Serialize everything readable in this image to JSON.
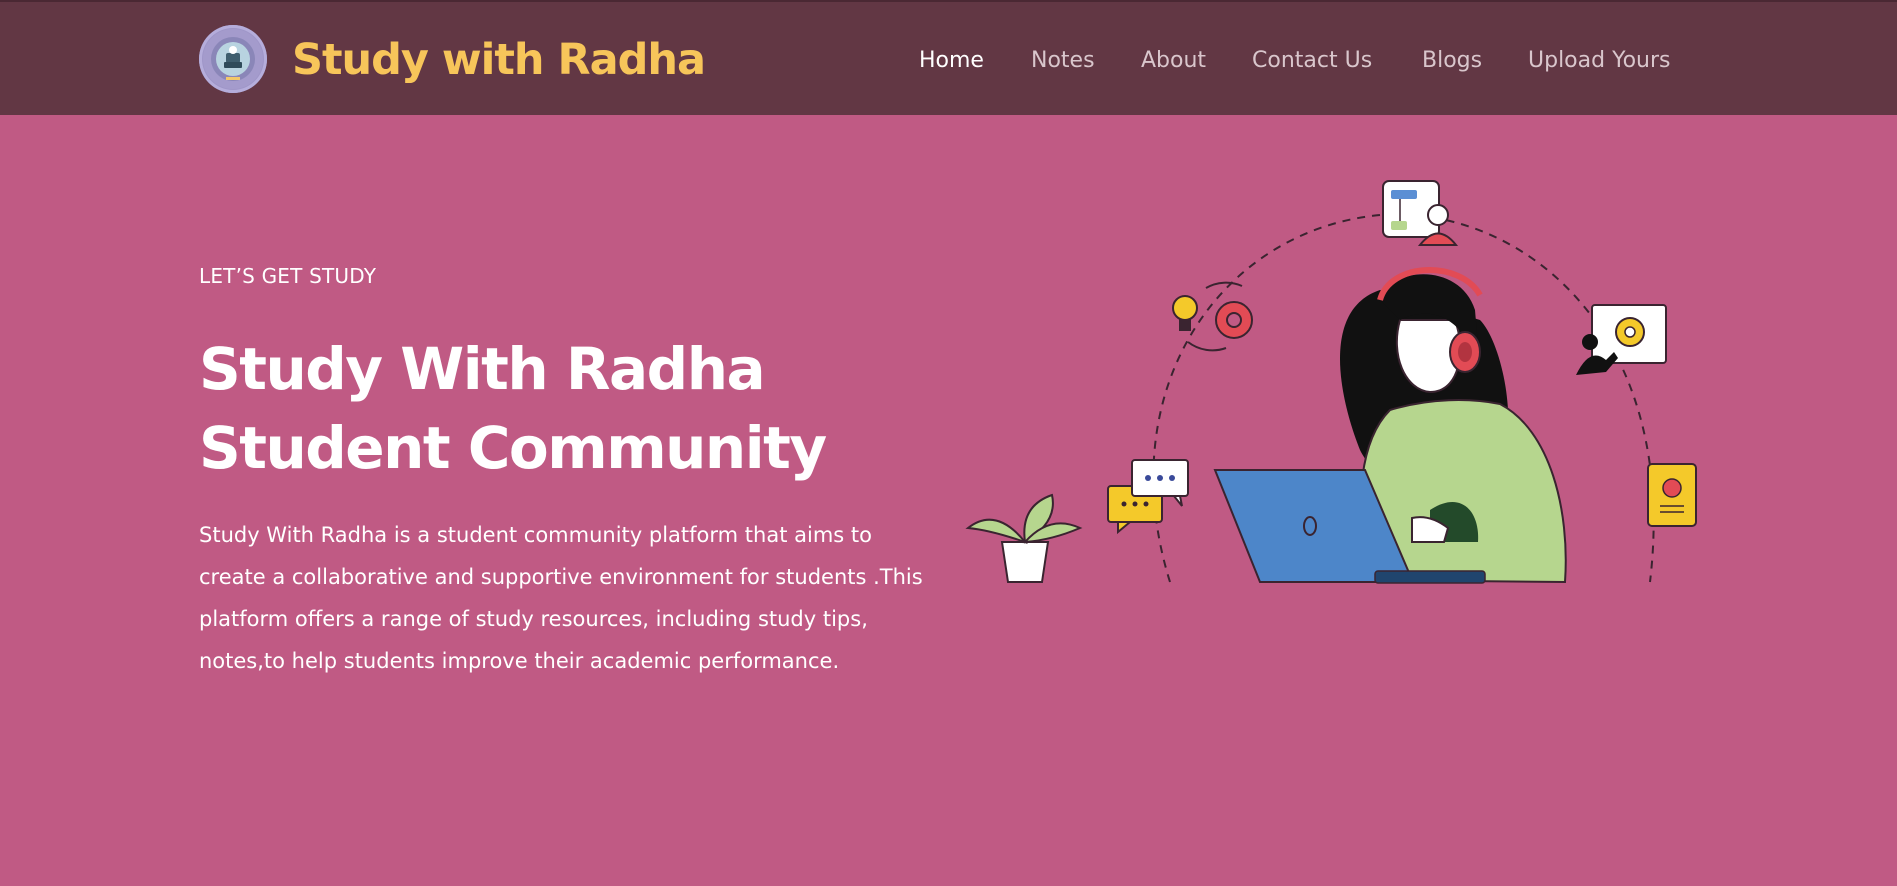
{
  "header": {
    "brand": "Study with Radha",
    "nav": [
      {
        "label": "Home",
        "active": true
      },
      {
        "label": "Notes",
        "active": false
      },
      {
        "label": "About",
        "active": false
      },
      {
        "label": "Contact Us",
        "active": false
      },
      {
        "label": "Blogs",
        "active": false
      },
      {
        "label": "Upload Yours",
        "active": false
      }
    ]
  },
  "hero": {
    "eyebrow": "LET’S GET STUDY",
    "title_line1": "Study With Radha",
    "title_line2": "Student Community",
    "description": "Study With Radha is a student community platform that aims to create a collaborative and supportive environment for students .This platform offers a range of study resources, including study tips, notes,to help students improve their academic performance."
  },
  "colors": {
    "page_background": "#c05a84",
    "header_background": "#623744",
    "brand": "#f7c55a",
    "nav_active": "#ffffff",
    "nav_inactive": "#d9c6cc"
  },
  "icons": [
    "logo-badge",
    "flowchart-presenter-icon",
    "lightbulb-icon",
    "gear-icon",
    "teacher-board-icon",
    "chat-bubbles-icon",
    "potted-plant-icon",
    "notebook-icon",
    "laptop-icon"
  ]
}
